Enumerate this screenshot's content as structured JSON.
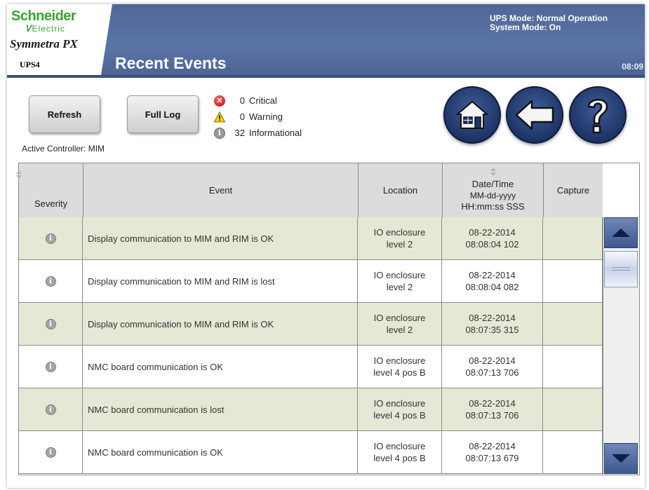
{
  "header": {
    "brand_name": "Schneider",
    "brand_sub_mark": "Ꮩ",
    "brand_sub": "Electric",
    "product": "Symmetra PX",
    "unit": "UPS4",
    "title": "Recent Events",
    "ups_mode": "UPS Mode: Normal Operation",
    "system_mode": "System Mode: On",
    "time": "08:09",
    "colors": {
      "bar": "#5a74a6",
      "brand": "#3aa335"
    }
  },
  "toolbar": {
    "refresh_label": "Refresh",
    "full_log_label": "Full Log",
    "critical_count": "0",
    "critical_label": "Critical",
    "warning_count": "0",
    "warning_label": "Warning",
    "info_count": "32",
    "info_label": "Informational",
    "active_controller": "Active Controller: MIM",
    "nav_icons": [
      "home-icon",
      "back-arrow-icon",
      "help-icon"
    ]
  },
  "table": {
    "headers": {
      "severity": "Severity",
      "event": "Event",
      "location": "Location",
      "datetime_1": "Date/Time",
      "datetime_2": "MM-dd-yyyy",
      "datetime_3": "HH:mm:ss SSS",
      "capture": "Capture"
    },
    "rows": [
      {
        "event": "Display communication to MIM and RIM is OK",
        "loc1": "IO enclosure",
        "loc2": "level 2",
        "date": "08-22-2014",
        "time": "08:08:04 102",
        "capture": ""
      },
      {
        "event": "Display communication to  MIM and RIM is lost",
        "loc1": "IO enclosure",
        "loc2": "level 2",
        "date": "08-22-2014",
        "time": "08:08:04 082",
        "capture": ""
      },
      {
        "event": "Display communication to MIM and RIM is OK",
        "loc1": "IO enclosure",
        "loc2": "level 2",
        "date": "08-22-2014",
        "time": "08:07:35 315",
        "capture": ""
      },
      {
        "event": "NMC board communication is OK",
        "loc1": "IO enclosure",
        "loc2": "level 4 pos B",
        "date": "08-22-2014",
        "time": "08:07:13 706",
        "capture": ""
      },
      {
        "event": "NMC board communication is lost",
        "loc1": "IO enclosure",
        "loc2": "level 4 pos B",
        "date": "08-22-2014",
        "time": "08:07:13 706",
        "capture": ""
      },
      {
        "event": "NMC board communication is OK",
        "loc1": "IO enclosure",
        "loc2": "level 4 pos B",
        "date": "08-22-2014",
        "time": "08:07:13 679",
        "capture": ""
      }
    ]
  }
}
